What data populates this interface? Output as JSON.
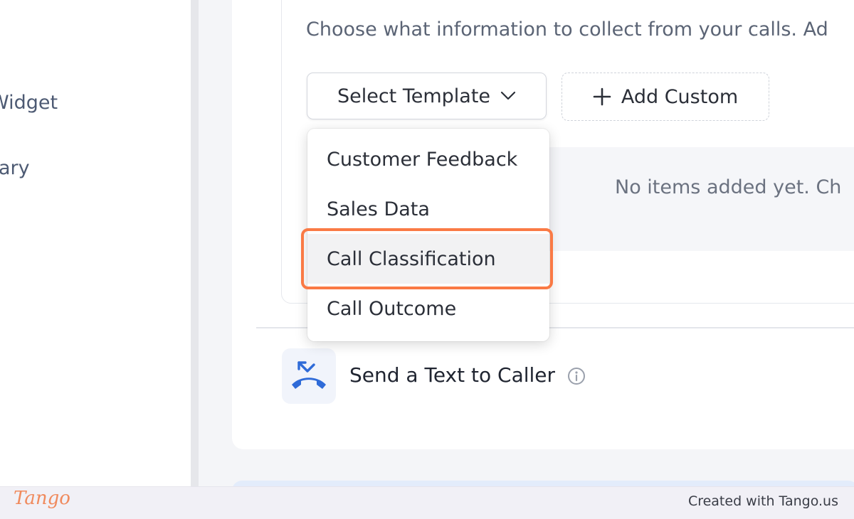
{
  "sidebar": {
    "items": [
      {
        "label": "Widget"
      },
      {
        "label": "ary"
      }
    ]
  },
  "data_collection": {
    "description": "Choose what information to collect from your calls. Ad",
    "select_template_label": "Select Template",
    "add_custom_label": "Add Custom",
    "empty_message": "No items added yet. Ch"
  },
  "template_dropdown": {
    "options": [
      {
        "label": "Customer Feedback"
      },
      {
        "label": "Sales Data"
      },
      {
        "label": "Call Classification"
      },
      {
        "label": "Call Outcome"
      }
    ],
    "highlighted": "Call Classification"
  },
  "send_text": {
    "label": "Send a Text to Caller"
  },
  "footer": {
    "logo_text": "Tango",
    "created_text": "Created with Tango.us"
  },
  "colors": {
    "highlight": "#fa7a45",
    "icon_blue": "#2f6bd8"
  },
  "icons": [
    "chevron-down-icon",
    "plus-icon",
    "phone-missed-icon",
    "info-icon"
  ]
}
